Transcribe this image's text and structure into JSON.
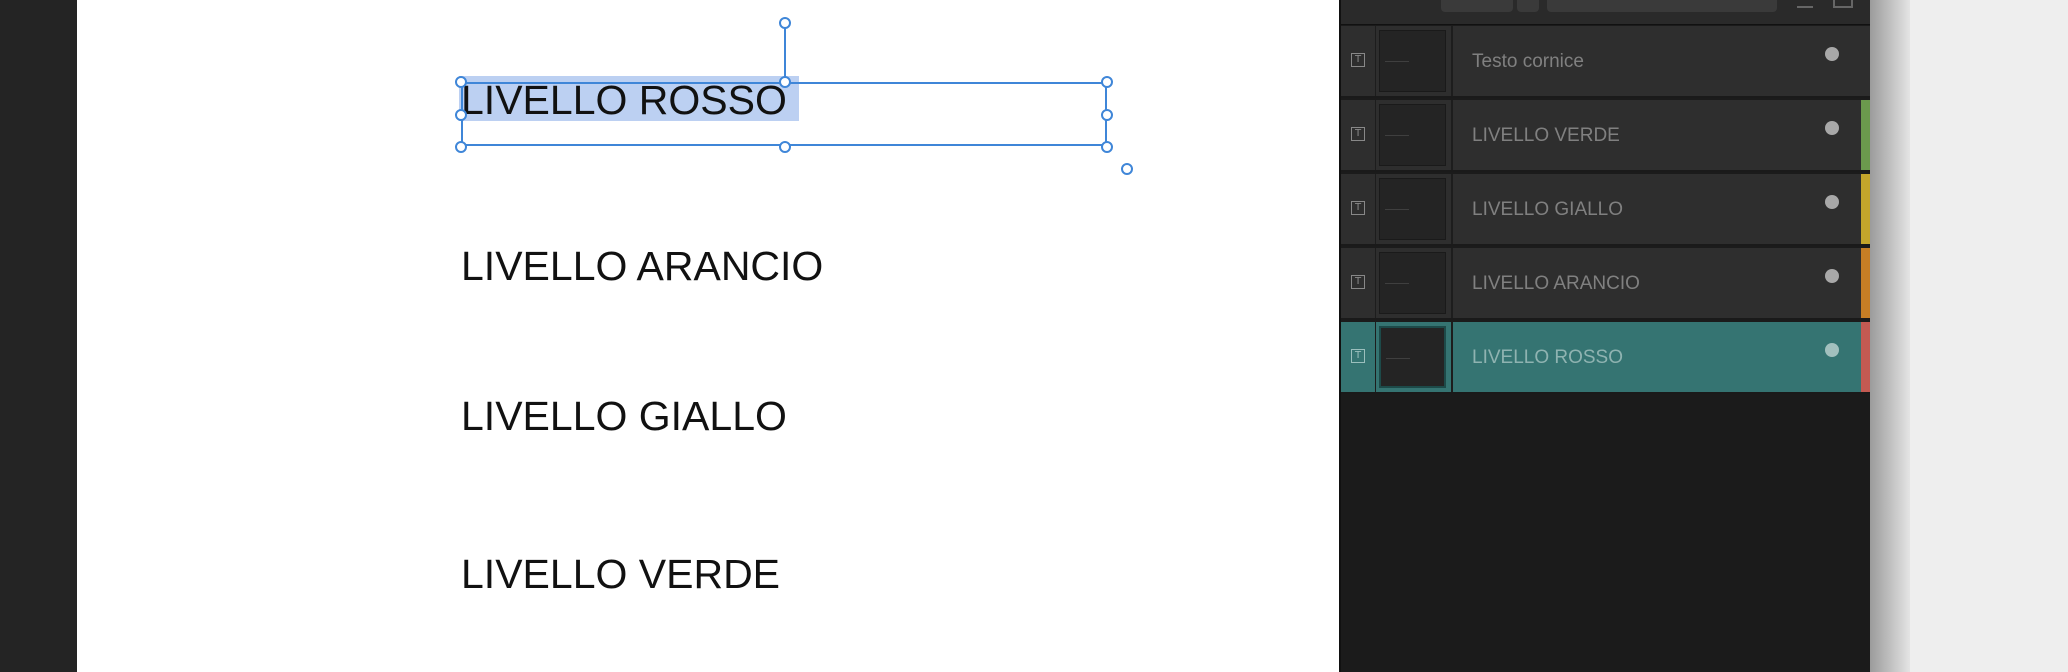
{
  "canvas": {
    "texts": [
      {
        "text": "LIVELLO ROSSO",
        "selected": true
      },
      {
        "text": "LIVELLO ARANCIO"
      },
      {
        "text": "LIVELLO GIALLO"
      },
      {
        "text": "LIVELLO VERDE"
      }
    ]
  },
  "layers_panel": {
    "items": [
      {
        "label": "Testo cornice",
        "type_icon": "text-frame-icon",
        "type_glyph": "T",
        "tag_color": ""
      },
      {
        "label": "LIVELLO VERDE",
        "type_icon": "text-frame-icon",
        "type_glyph": "T",
        "tag_color": "#6b9a4d"
      },
      {
        "label": "LIVELLO GIALLO",
        "type_icon": "text-frame-icon",
        "type_glyph": "T",
        "tag_color": "#c4a52b"
      },
      {
        "label": "LIVELLO ARANCIO",
        "type_icon": "text-frame-icon",
        "type_glyph": "T",
        "tag_color": "#c67e25"
      },
      {
        "label": "LIVELLO ROSSO",
        "type_icon": "text-frame-icon",
        "type_glyph": "T",
        "tag_color": "#c35a52",
        "selected": true
      }
    ]
  },
  "colors": {
    "selection": "#3f86d8",
    "text_highlight": "#bcd0f2",
    "selected_row": "#357472",
    "panel_bg": "#1b1b1b",
    "row_bg": "#2e2e2e"
  }
}
